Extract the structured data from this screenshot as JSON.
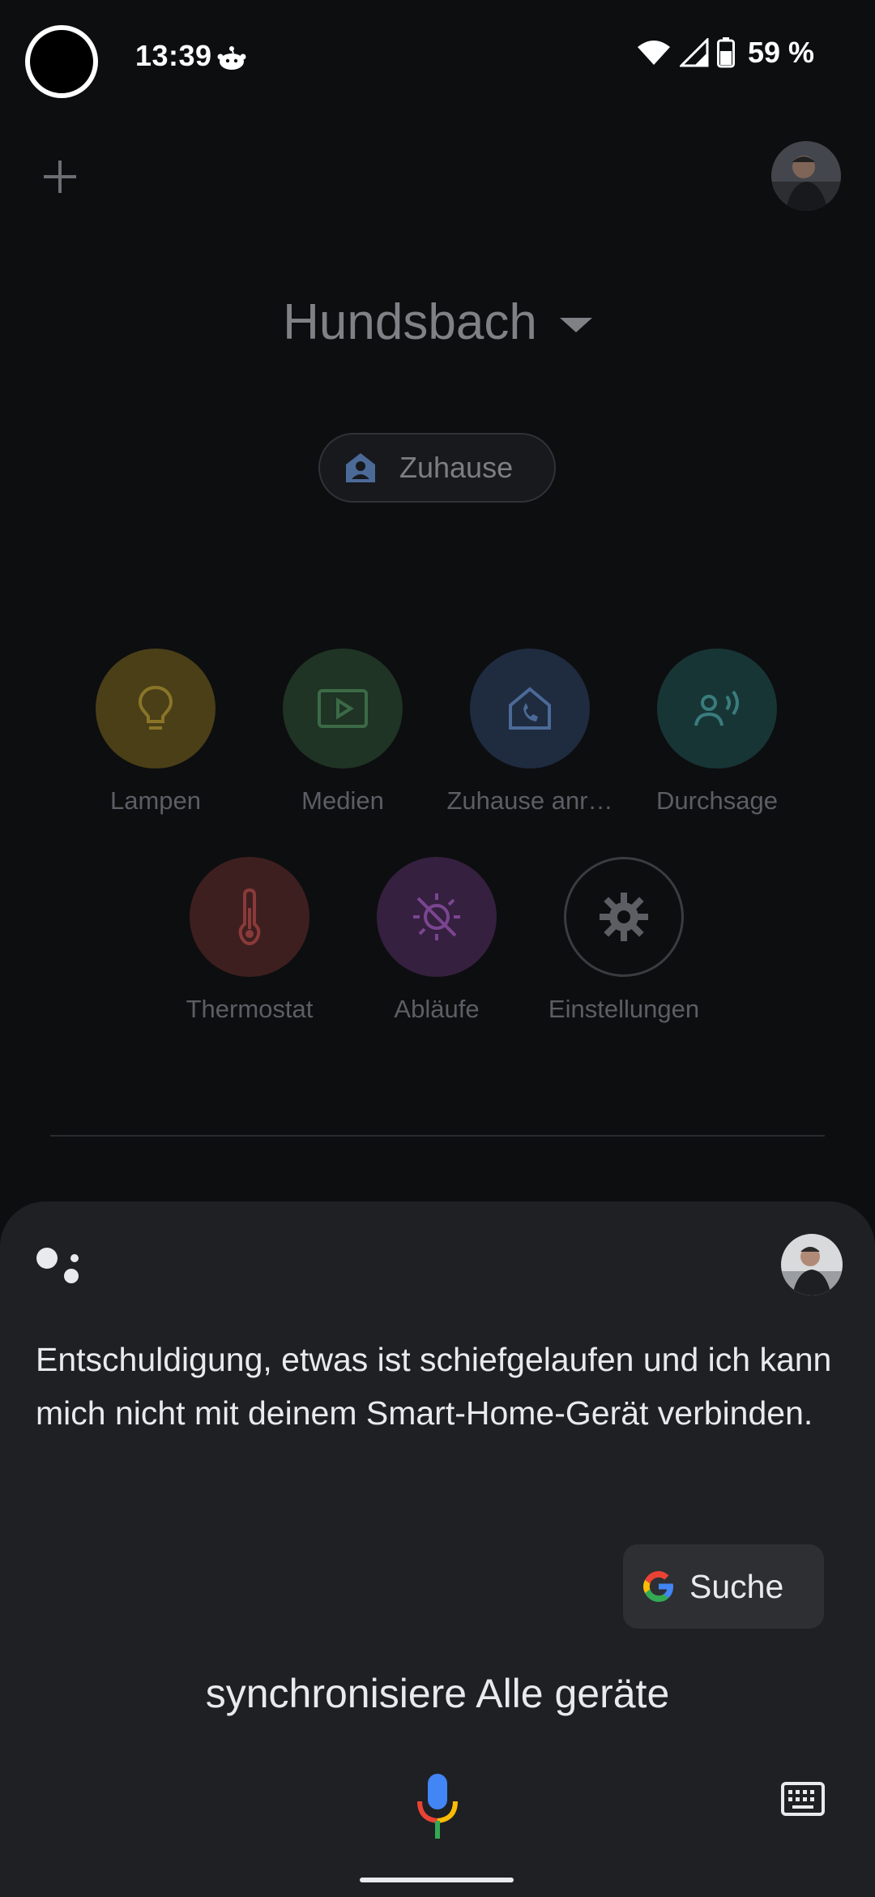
{
  "status_bar": {
    "time": "13:39",
    "battery_text": "59 %",
    "icons": [
      "reddit-notification-icon",
      "wifi-icon",
      "cellular-signal-icon",
      "battery-icon"
    ]
  },
  "home": {
    "title": "Hundsbach",
    "chip_label": "Zuhause",
    "tiles": [
      {
        "label": "Lampen",
        "icon": "lightbulb-icon",
        "color": "#4a3f17",
        "icon_color": "#8a7428"
      },
      {
        "label": "Medien",
        "icon": "media-play-icon",
        "color": "#1f3424",
        "icon_color": "#3c6a47"
      },
      {
        "label": "Zuhause anr…",
        "icon": "call-home-icon",
        "color": "#1f2b3f",
        "icon_color": "#4b6a98"
      },
      {
        "label": "Durchsage",
        "icon": "broadcast-icon",
        "color": "#183536",
        "icon_color": "#3a7c7e"
      },
      {
        "label": "Thermostat",
        "icon": "thermometer-icon",
        "color": "#3e1f1f",
        "icon_color": "#8a3a3a"
      },
      {
        "label": "Abläufe",
        "icon": "routines-icon",
        "color": "#35203f",
        "icon_color": "#7a4590"
      },
      {
        "label": "Einstellungen",
        "icon": "gear-icon",
        "color": "#0d0e10",
        "icon_color": "#5b5e63"
      }
    ]
  },
  "assistant": {
    "message": "Entschuldigung, etwas ist schiefgelaufen und ich kann mich nicht mit deinem Smart-Home-Gerät verbinden.",
    "search_chip_label": "Suche",
    "query": "synchronisiere Alle geräte"
  }
}
